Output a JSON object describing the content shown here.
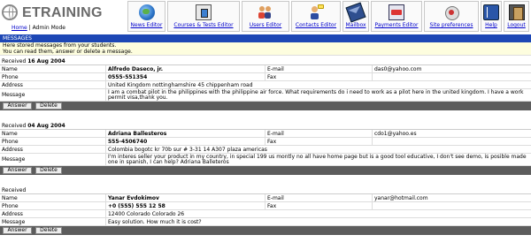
{
  "app": {
    "logo_text": "ETRAINING",
    "home_link": "Home",
    "separator": " | ",
    "mode": "Admin Mode"
  },
  "nav": [
    {
      "label": "News Editor",
      "icon": "globe-news-icon"
    },
    {
      "label": "Courses & Tests Editor",
      "icon": "course-book-icon"
    },
    {
      "label": "Users Editor",
      "icon": "users-icon"
    },
    {
      "label": "Contacts Editor",
      "icon": "contacts-icon"
    },
    {
      "label": "Mailbox",
      "icon": "mailbox-icon"
    },
    {
      "label": "Payments Editor",
      "icon": "payments-icon"
    },
    {
      "label": "Site preferences",
      "icon": "preferences-icon"
    },
    {
      "label": "Help",
      "icon": "help-book-icon"
    },
    {
      "label": "Logout",
      "icon": "logout-door-icon"
    }
  ],
  "section_title": "MESSAGES",
  "intro": {
    "line1": "Here stored messages from your students.",
    "line2": "You can read them, answer or delete a message."
  },
  "labels": {
    "received": "Received",
    "name": "Name",
    "email": "E-mail",
    "phone": "Phone",
    "fax": "Fax",
    "address": "Address",
    "message": "Message",
    "answer": "Answer",
    "delete": "Delete"
  },
  "messages": [
    {
      "received": "16 Aug 2004",
      "name": "Alfredo Daseco, jr.",
      "email": "das0@yahoo.com",
      "phone": "0555-551354",
      "fax": "",
      "address": "United Kingdom nottinghamshire 45 chippenham road",
      "message": "I am a combat pilot in the philippines with the philippine air force. What requirements do i need to work as a pilot here in the united kingdom. I have a work permit visa,thank you."
    },
    {
      "received": "04 Aug 2004",
      "name": "Adriana Ballesteros",
      "email": "cdo1@yahoo.es",
      "phone": "555-4506740",
      "fax": "",
      "address": "Colombia bogotc kr 70b sur # 3-31 14 A307 plaza americas",
      "message": "I'm interes seller your product in my country, in special 199 us montly no all have home page but is a good tool educative, I don't see demo, is posible made one in spanish, I can help? Adriana Balleteros"
    },
    {
      "received": "",
      "name": "Yanar Evdokimov",
      "email": "yanar@hotmail.com",
      "phone": "+0 (555) 555 12 58",
      "fax": "",
      "address": "12400 Colorado Colorado 26",
      "message": "Easy solution. How much it is cost?"
    }
  ]
}
